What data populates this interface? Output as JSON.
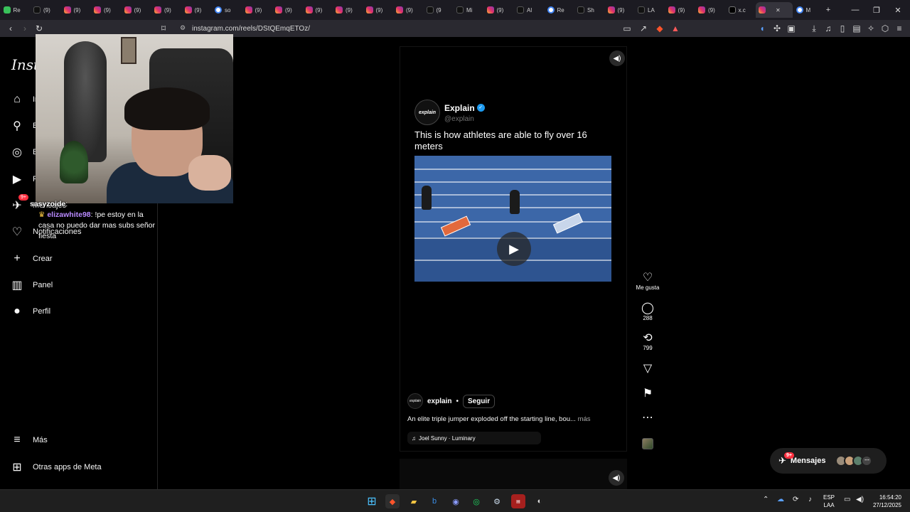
{
  "browser": {
    "tabs": [
      {
        "icon": "grid-app-icon",
        "label": "Re",
        "kind": "gr"
      },
      {
        "icon": "tiktok-icon",
        "label": "(9)",
        "kind": "tt"
      },
      {
        "icon": "instagram-icon",
        "label": "(9)",
        "kind": "ig"
      },
      {
        "icon": "instagram-icon",
        "label": "(9)",
        "kind": "ig"
      },
      {
        "icon": "instagram-icon",
        "label": "(9)",
        "kind": "ig"
      },
      {
        "icon": "instagram-icon",
        "label": "(9)",
        "kind": "ig"
      },
      {
        "icon": "instagram-icon",
        "label": "(9)",
        "kind": "ig"
      },
      {
        "icon": "google-icon",
        "label": "so",
        "kind": "gl"
      },
      {
        "icon": "instagram-icon",
        "label": "(9)",
        "kind": "ig"
      },
      {
        "icon": "instagram-icon",
        "label": "(9)",
        "kind": "ig"
      },
      {
        "icon": "instagram-icon",
        "label": "(9)",
        "kind": "ig"
      },
      {
        "icon": "instagram-icon",
        "label": "(9)",
        "kind": "ig"
      },
      {
        "icon": "instagram-icon",
        "label": "(9)",
        "kind": "ig"
      },
      {
        "icon": "instagram-icon",
        "label": "(9)",
        "kind": "ig"
      },
      {
        "icon": "tiktok-icon",
        "label": "(9",
        "kind": "tt"
      },
      {
        "icon": "tiktok-icon",
        "label": "Mi",
        "kind": "tt"
      },
      {
        "icon": "instagram-icon",
        "label": "(9)",
        "kind": "ig"
      },
      {
        "icon": "tiktok-icon",
        "label": "Al",
        "kind": "tt"
      },
      {
        "icon": "globe-icon",
        "label": "Re",
        "kind": "gl"
      },
      {
        "icon": "tiktok-icon",
        "label": "Sh",
        "kind": "tt"
      },
      {
        "icon": "instagram-icon",
        "label": "(9)",
        "kind": "ig"
      },
      {
        "icon": "tiktok-icon",
        "label": "LA",
        "kind": "tt"
      },
      {
        "icon": "instagram-icon",
        "label": "(9)",
        "kind": "ig"
      },
      {
        "icon": "instagram-icon",
        "label": "(9)",
        "kind": "ig"
      },
      {
        "icon": "x-icon",
        "label": "x.c",
        "kind": "x"
      },
      {
        "icon": "speaker-icon",
        "label": "",
        "kind": "ig",
        "active": true
      },
      {
        "icon": "globe-icon",
        "label": "M",
        "kind": "gl"
      }
    ],
    "new_tab": "+",
    "window": {
      "minimize": "—",
      "maximize": "❐",
      "close": "✕"
    },
    "url": "instagram.com/reels/DStQEmqETOz/"
  },
  "sidebar": {
    "logo": "Insta",
    "items": [
      {
        "icon": "home-icon",
        "glyph": "⌂",
        "label": "Inicio"
      },
      {
        "icon": "search-icon",
        "glyph": "⚲",
        "label": "Buscar"
      },
      {
        "icon": "explore-icon",
        "glyph": "◎",
        "label": "Explorar"
      },
      {
        "icon": "reels-icon",
        "glyph": "▶",
        "label": "Reels"
      },
      {
        "icon": "messages-icon",
        "glyph": "✈",
        "label": "Mensajes",
        "badge": "9+"
      },
      {
        "icon": "heart-icon",
        "glyph": "♡",
        "label": "Notificaciones"
      },
      {
        "icon": "create-icon",
        "glyph": "+",
        "label": "Crear"
      },
      {
        "icon": "dashboard-icon",
        "glyph": "▥",
        "label": "Panel"
      },
      {
        "icon": "profile-icon",
        "glyph": "●",
        "label": "Perfil"
      }
    ],
    "more": {
      "icon": "menu-icon",
      "glyph": "≡",
      "label": "Más"
    },
    "meta_apps": {
      "icon": "apps-icon",
      "glyph": "⊞",
      "label": "Otras apps de Meta"
    }
  },
  "stream_chat": {
    "line1_user": "sasyzoide",
    "line2_user": "elizawhite98",
    "line2_text": "!pe estoy en la casa no puedo dar mas subs señor fiesta"
  },
  "reel": {
    "post_author": "Explain",
    "post_handle": "@explain",
    "post_avatar_text": "explain",
    "post_text": "This is how athletes are able to fly over 16 meters",
    "account": "explain",
    "follow_label": "Seguir",
    "caption": "An elite triple jumper exploded off the starting line, bou...",
    "caption_more": "más",
    "audio": "Joel Sunny · Luminary",
    "separator": "•"
  },
  "actions": {
    "like_label": "Me gusta",
    "comments": "288",
    "reposts": "799"
  },
  "messages": {
    "label": "Mensajes",
    "badge": "9+"
  },
  "taskbar": {
    "lang_line1": "ESP",
    "lang_line2": "LAA",
    "time": "16:54:20",
    "date": "27/12/2025"
  },
  "colors": {
    "accent_blue": "#1d9bf0",
    "badge_red": "#ff3040",
    "track_blue": "#3c67a8"
  }
}
